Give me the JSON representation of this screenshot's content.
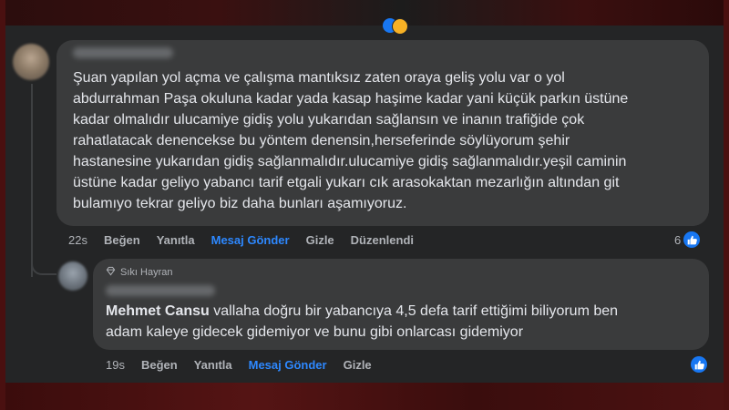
{
  "colors": {
    "background": "#242526",
    "bubble": "#3a3b3c",
    "text": "#e4e6eb",
    "secondary_text": "#b0b3b8",
    "accent": "#2d88ff",
    "like_blue": "#1877f2",
    "frame_red": "#4a1010"
  },
  "comment": {
    "avatar_icon": "avatar-blurred",
    "author_blurred": true,
    "text_lines": [
      "Şuan yapılan yol açma ve çalışma mantıksız zaten oraya geliş yolu var o yol",
      "abdurrahman Paşa okuluna kadar yada kasap haşime kadar yani küçük parkın üstüne",
      "kadar olmalıdır ulucamiye gidiş yolu yukarıdan sağlansın ve inanın trafiğide çok",
      "rahatlatacak denencekse bu yöntem denensin,herseferinde söylüyorum şehir",
      "hastanesine yukarıdan gidiş sağlanmalıdır.ulucamiye gidiş sağlanmalıdır.yeşil caminin",
      "üstüne kadar geliyo yabancı tarif etgali yukarı cık arasokaktan mezarlığın altından git",
      "bulamıyo tekrar geliyo biz daha bunları aşamıyoruz."
    ],
    "actions": {
      "time": "22s",
      "like": "Beğen",
      "reply": "Yanıtla",
      "send_message": "Mesaj Gönder",
      "hide": "Gizle",
      "edited": "Düzenlendi"
    },
    "reaction_count": "6",
    "reaction_icon": "like-icon"
  },
  "reply": {
    "badge_icon": "diamond-icon",
    "badge": "Sıkı Hayran",
    "author_blurred": true,
    "author": "Mehmet Cansu",
    "text_line1": " vallaha doğru bir yabancıya 4,5 defa tarif ettiğimi biliyorum ben",
    "text_line2": "adam kaleye gidecek gidemiyor ve bunu gibi onlarcası gidemiyor",
    "actions": {
      "time": "19s",
      "like": "Beğen",
      "reply": "Yanıtla",
      "send_message": "Mesaj Gönder",
      "hide": "Gizle"
    },
    "reaction_icon": "like-icon"
  }
}
